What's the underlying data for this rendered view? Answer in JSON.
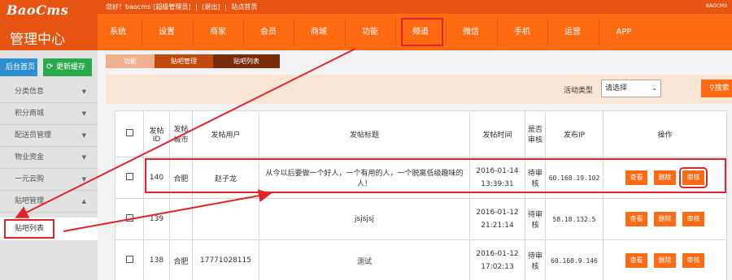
{
  "brand": {
    "logo_en": "BaoCms",
    "logo_cn": "管理中心"
  },
  "topbar": {
    "greeting": "您好！baocms",
    "role": "[超级管理员]",
    "sep1": "|",
    "logout": "[退出]",
    "sep2": "|",
    "site_home": "站点首页",
    "right_text": "BAOCMS"
  },
  "nav": [
    "系统",
    "设置",
    "商家",
    "会员",
    "商城",
    "功能",
    "频道",
    "微信",
    "手机",
    "运营",
    "APP"
  ],
  "nav_active_index": 6,
  "sidebar": {
    "home_button": "后台首页",
    "refresh_button": "更新缓存",
    "items": [
      "分类信息",
      "积分商城",
      "配送员管理",
      "物业资金",
      "一元云购",
      "贴吧管理"
    ],
    "active_item": "贴吧列表"
  },
  "breadcrumb": [
    "功能",
    "贴吧管理",
    "贴吧列表"
  ],
  "filter": {
    "label": "活动类型",
    "select_value": "请选择",
    "search_button": "搜索"
  },
  "table": {
    "headers": {
      "id": "发帖ID",
      "city": "发帖城市",
      "user": "发帖用户",
      "title": "发帖标题",
      "time": "发帖时间",
      "audited": "是否审核",
      "ip": "发布IP",
      "ops": "操作"
    },
    "rows": [
      {
        "id": "140",
        "city": "合肥",
        "user": "赵子龙",
        "title": "从今以后要做一个好人，一个有用的人，一个脱离低级趣味的人！",
        "date": "2016-01-14",
        "time": "13:39:31",
        "audit": "待审核",
        "ip": "60.168.19.102"
      },
      {
        "id": "139",
        "city": "",
        "user": "",
        "title": "jsjsjsj",
        "date": "2016-01-12",
        "time": "21:21:14",
        "audit": "待审核",
        "ip": "58.18.132.5"
      },
      {
        "id": "138",
        "city": "合肥",
        "user": "17771028115",
        "title": "测试",
        "date": "2016-01-12",
        "time": "17:02:13",
        "audit": "待审核",
        "ip": "60.168.9.146"
      }
    ],
    "op_labels": {
      "view": "查看",
      "delete": "删除",
      "audit": "审核"
    }
  },
  "colors": {
    "brand_orange": "#ff6a12",
    "header_dark": "#e85412",
    "highlight_red": "#e0242a"
  }
}
